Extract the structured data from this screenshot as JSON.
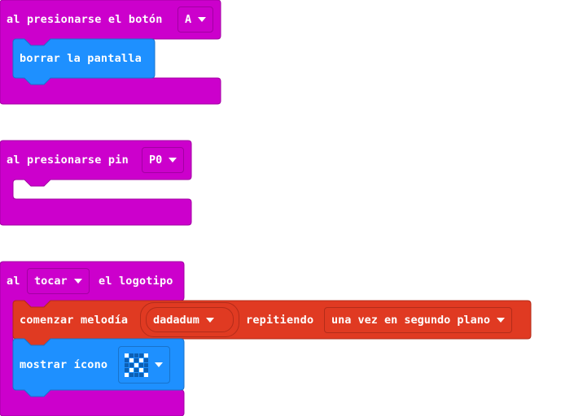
{
  "colors": {
    "input_block": "#cc00cc",
    "basic_block": "#1e90ff",
    "music_block": "#e03a22"
  },
  "block_button": {
    "label": "al presionarse el botón",
    "button_value": "A",
    "inner_label": "borrar la pantalla"
  },
  "block_pin": {
    "label": "al presionarse pin",
    "pin_value": "P0"
  },
  "block_logo": {
    "label_prefix": "al",
    "action_value": "tocar",
    "label_suffix": "el logotipo",
    "melody": {
      "label": "comenzar melodía",
      "melody_value": "dadadum",
      "repeat_label": "repitiendo",
      "repeat_value": "una vez en segundo plano"
    },
    "show_icon": {
      "label": "mostrar ícono",
      "icon_name": "x-icon",
      "icon_pixels": [
        1,
        0,
        0,
        0,
        1,
        0,
        1,
        0,
        1,
        0,
        0,
        0,
        1,
        0,
        0,
        0,
        1,
        0,
        1,
        0,
        1,
        0,
        0,
        0,
        1
      ]
    }
  }
}
